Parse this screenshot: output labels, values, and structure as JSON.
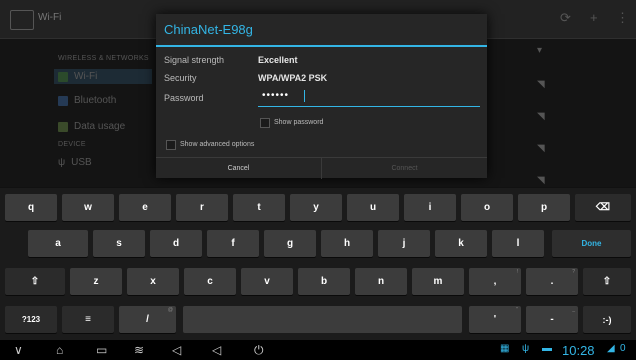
{
  "background": {
    "actionbar_title": "Wi-Fi",
    "section_wireless": "WIRELESS & NETWORKS",
    "section_device": "DEVICE",
    "items": [
      {
        "label": "Wi-Fi",
        "icon": "wifi-icon"
      },
      {
        "label": "Bluetooth",
        "icon": "bluetooth-icon"
      },
      {
        "label": "Data usage",
        "icon": "data-usage-icon"
      },
      {
        "label": "USB",
        "icon": "usb-icon"
      }
    ]
  },
  "dialog": {
    "title": "ChinaNet-E98g",
    "signal_label": "Signal strength",
    "signal_value": "Excellent",
    "security_label": "Security",
    "security_value": "WPA/WPA2 PSK",
    "password_label": "Password",
    "password_value": "••••••",
    "show_password": "Show password",
    "show_advanced": "Show advanced options",
    "cancel": "Cancel",
    "connect": "Connect"
  },
  "keyboard": {
    "row1": [
      "q",
      "w",
      "e",
      "r",
      "t",
      "y",
      "u",
      "i",
      "o",
      "p"
    ],
    "row2": [
      "a",
      "s",
      "d",
      "f",
      "g",
      "h",
      "j",
      "k",
      "l"
    ],
    "row3": [
      "z",
      "x",
      "c",
      "v",
      "b",
      "n",
      "m"
    ],
    "done": "Done",
    "symbols": "?123",
    "slash": "/",
    "right_emoticon": ":-)",
    "backspace_icon": "backspace-icon",
    "shift_icon": "shift-icon"
  },
  "system_bar": {
    "clock": "10:28",
    "notification_count": "0"
  },
  "colors": {
    "accent": "#33b5e5",
    "key": "#3c3c3c",
    "dialog": "#262626"
  }
}
